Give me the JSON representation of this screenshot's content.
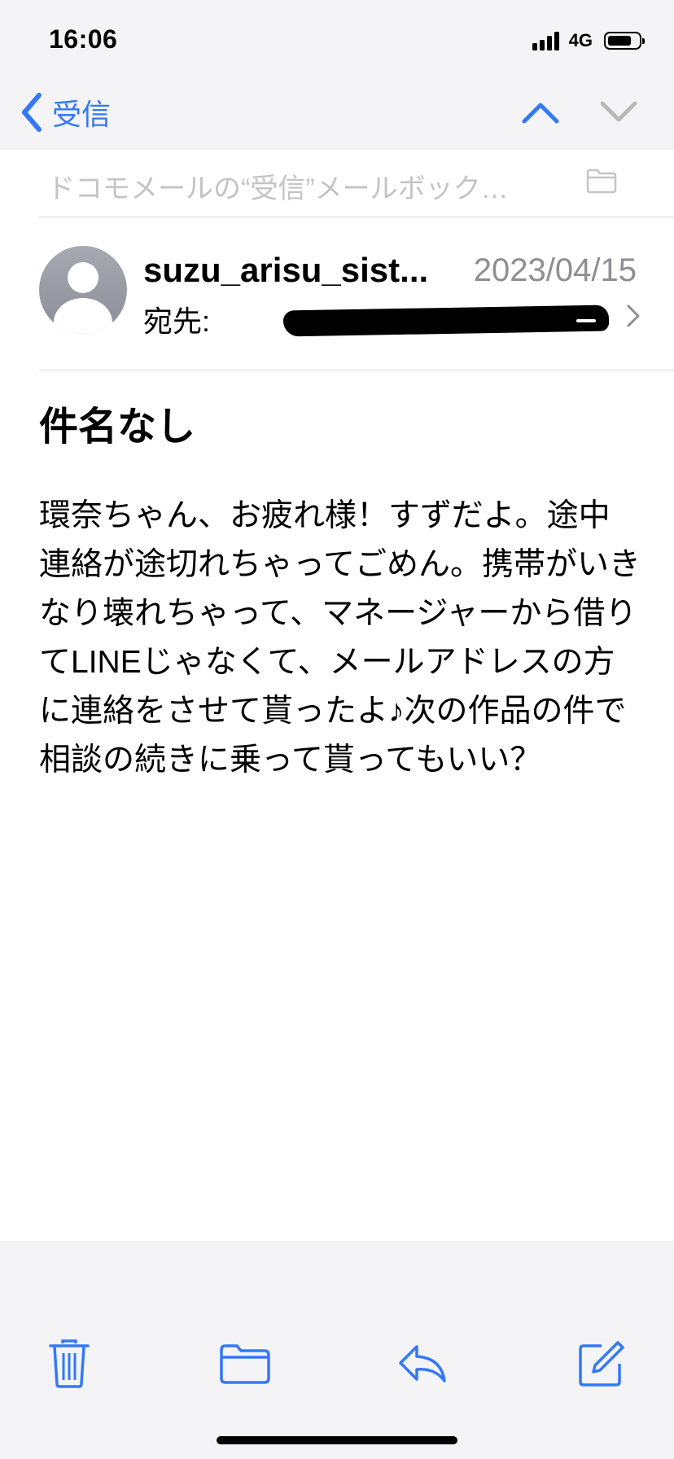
{
  "status_bar": {
    "time": "16:06",
    "network": "4G"
  },
  "nav": {
    "back_label": "受信"
  },
  "mailbox": {
    "label": "ドコモメールの“受信”メールボック…"
  },
  "message": {
    "sender": "suzu_arisu_sist...",
    "date": "2023/04/15",
    "to_label": "宛先:",
    "subject": "件名なし",
    "body": "環奈ちゃん、お疲れ様！すずだよ。途中連絡が途切れちゃってごめん。携帯がいきなり壊れちゃって、マネージャーから借りてLINEじゃなくて、メールアドレスの方に連絡をさせて貰ったよ♪次の作品の件で相談の続きに乗って貰ってもいい？"
  },
  "icons": {
    "back": "chevron-left-icon",
    "up": "chevron-up-icon",
    "down": "chevron-down-icon",
    "folder": "folder-icon",
    "trash": "trash-icon",
    "reply": "reply-icon",
    "compose": "compose-icon"
  },
  "colors": {
    "accent": "#3478f6",
    "muted": "#8e8e93",
    "disabled": "#c4c4c8"
  }
}
